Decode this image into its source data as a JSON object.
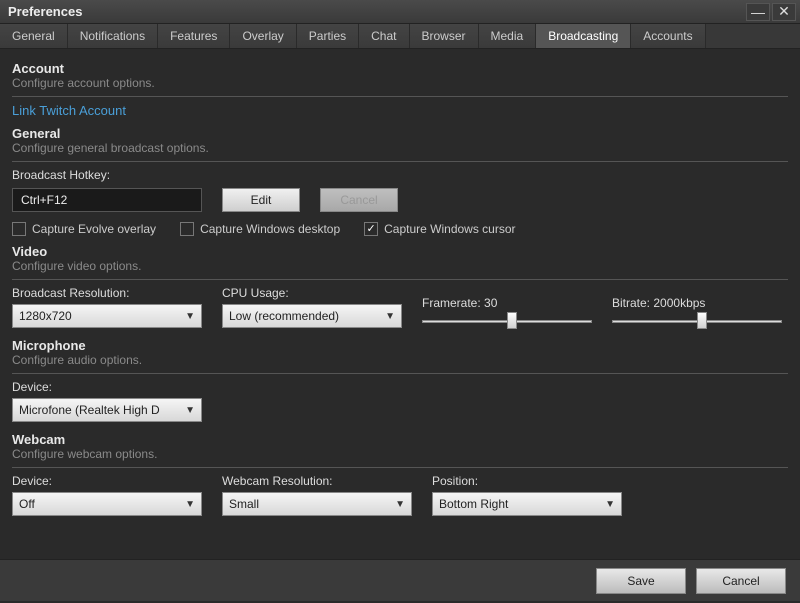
{
  "window": {
    "title": "Preferences"
  },
  "tabs": [
    "General",
    "Notifications",
    "Features",
    "Overlay",
    "Parties",
    "Chat",
    "Browser",
    "Media",
    "Broadcasting",
    "Accounts"
  ],
  "active_tab": "Broadcasting",
  "account": {
    "title": "Account",
    "subtitle": "Configure account options.",
    "link": "Link Twitch Account"
  },
  "general": {
    "title": "General",
    "subtitle": "Configure general broadcast options.",
    "hotkey_label": "Broadcast Hotkey:",
    "hotkey_value": "Ctrl+F12",
    "edit_label": "Edit",
    "cancel_label": "Cancel",
    "cb_overlay": "Capture Evolve overlay",
    "cb_desktop": "Capture Windows desktop",
    "cb_cursor": "Capture Windows cursor",
    "cb_overlay_checked": false,
    "cb_desktop_checked": false,
    "cb_cursor_checked": true
  },
  "video": {
    "title": "Video",
    "subtitle": "Configure video options.",
    "resolution_label": "Broadcast Resolution:",
    "resolution_value": "1280x720",
    "cpu_label": "CPU Usage:",
    "cpu_value": "Low (recommended)",
    "framerate_label": "Framerate:",
    "framerate_value": "30",
    "framerate_min": 0,
    "framerate_max": 60,
    "bitrate_label": "Bitrate:",
    "bitrate_value": "2000",
    "bitrate_unit": "kbps",
    "bitrate_min": 0,
    "bitrate_max": 4000
  },
  "microphone": {
    "title": "Microphone",
    "subtitle": "Configure audio options.",
    "device_label": "Device:",
    "device_value": "Microfone (Realtek High D"
  },
  "webcam": {
    "title": "Webcam",
    "subtitle": "Configure webcam options.",
    "device_label": "Device:",
    "device_value": "Off",
    "resolution_label": "Webcam Resolution:",
    "resolution_value": "Small",
    "position_label": "Position:",
    "position_value": "Bottom Right"
  },
  "footer": {
    "save": "Save",
    "cancel": "Cancel"
  }
}
